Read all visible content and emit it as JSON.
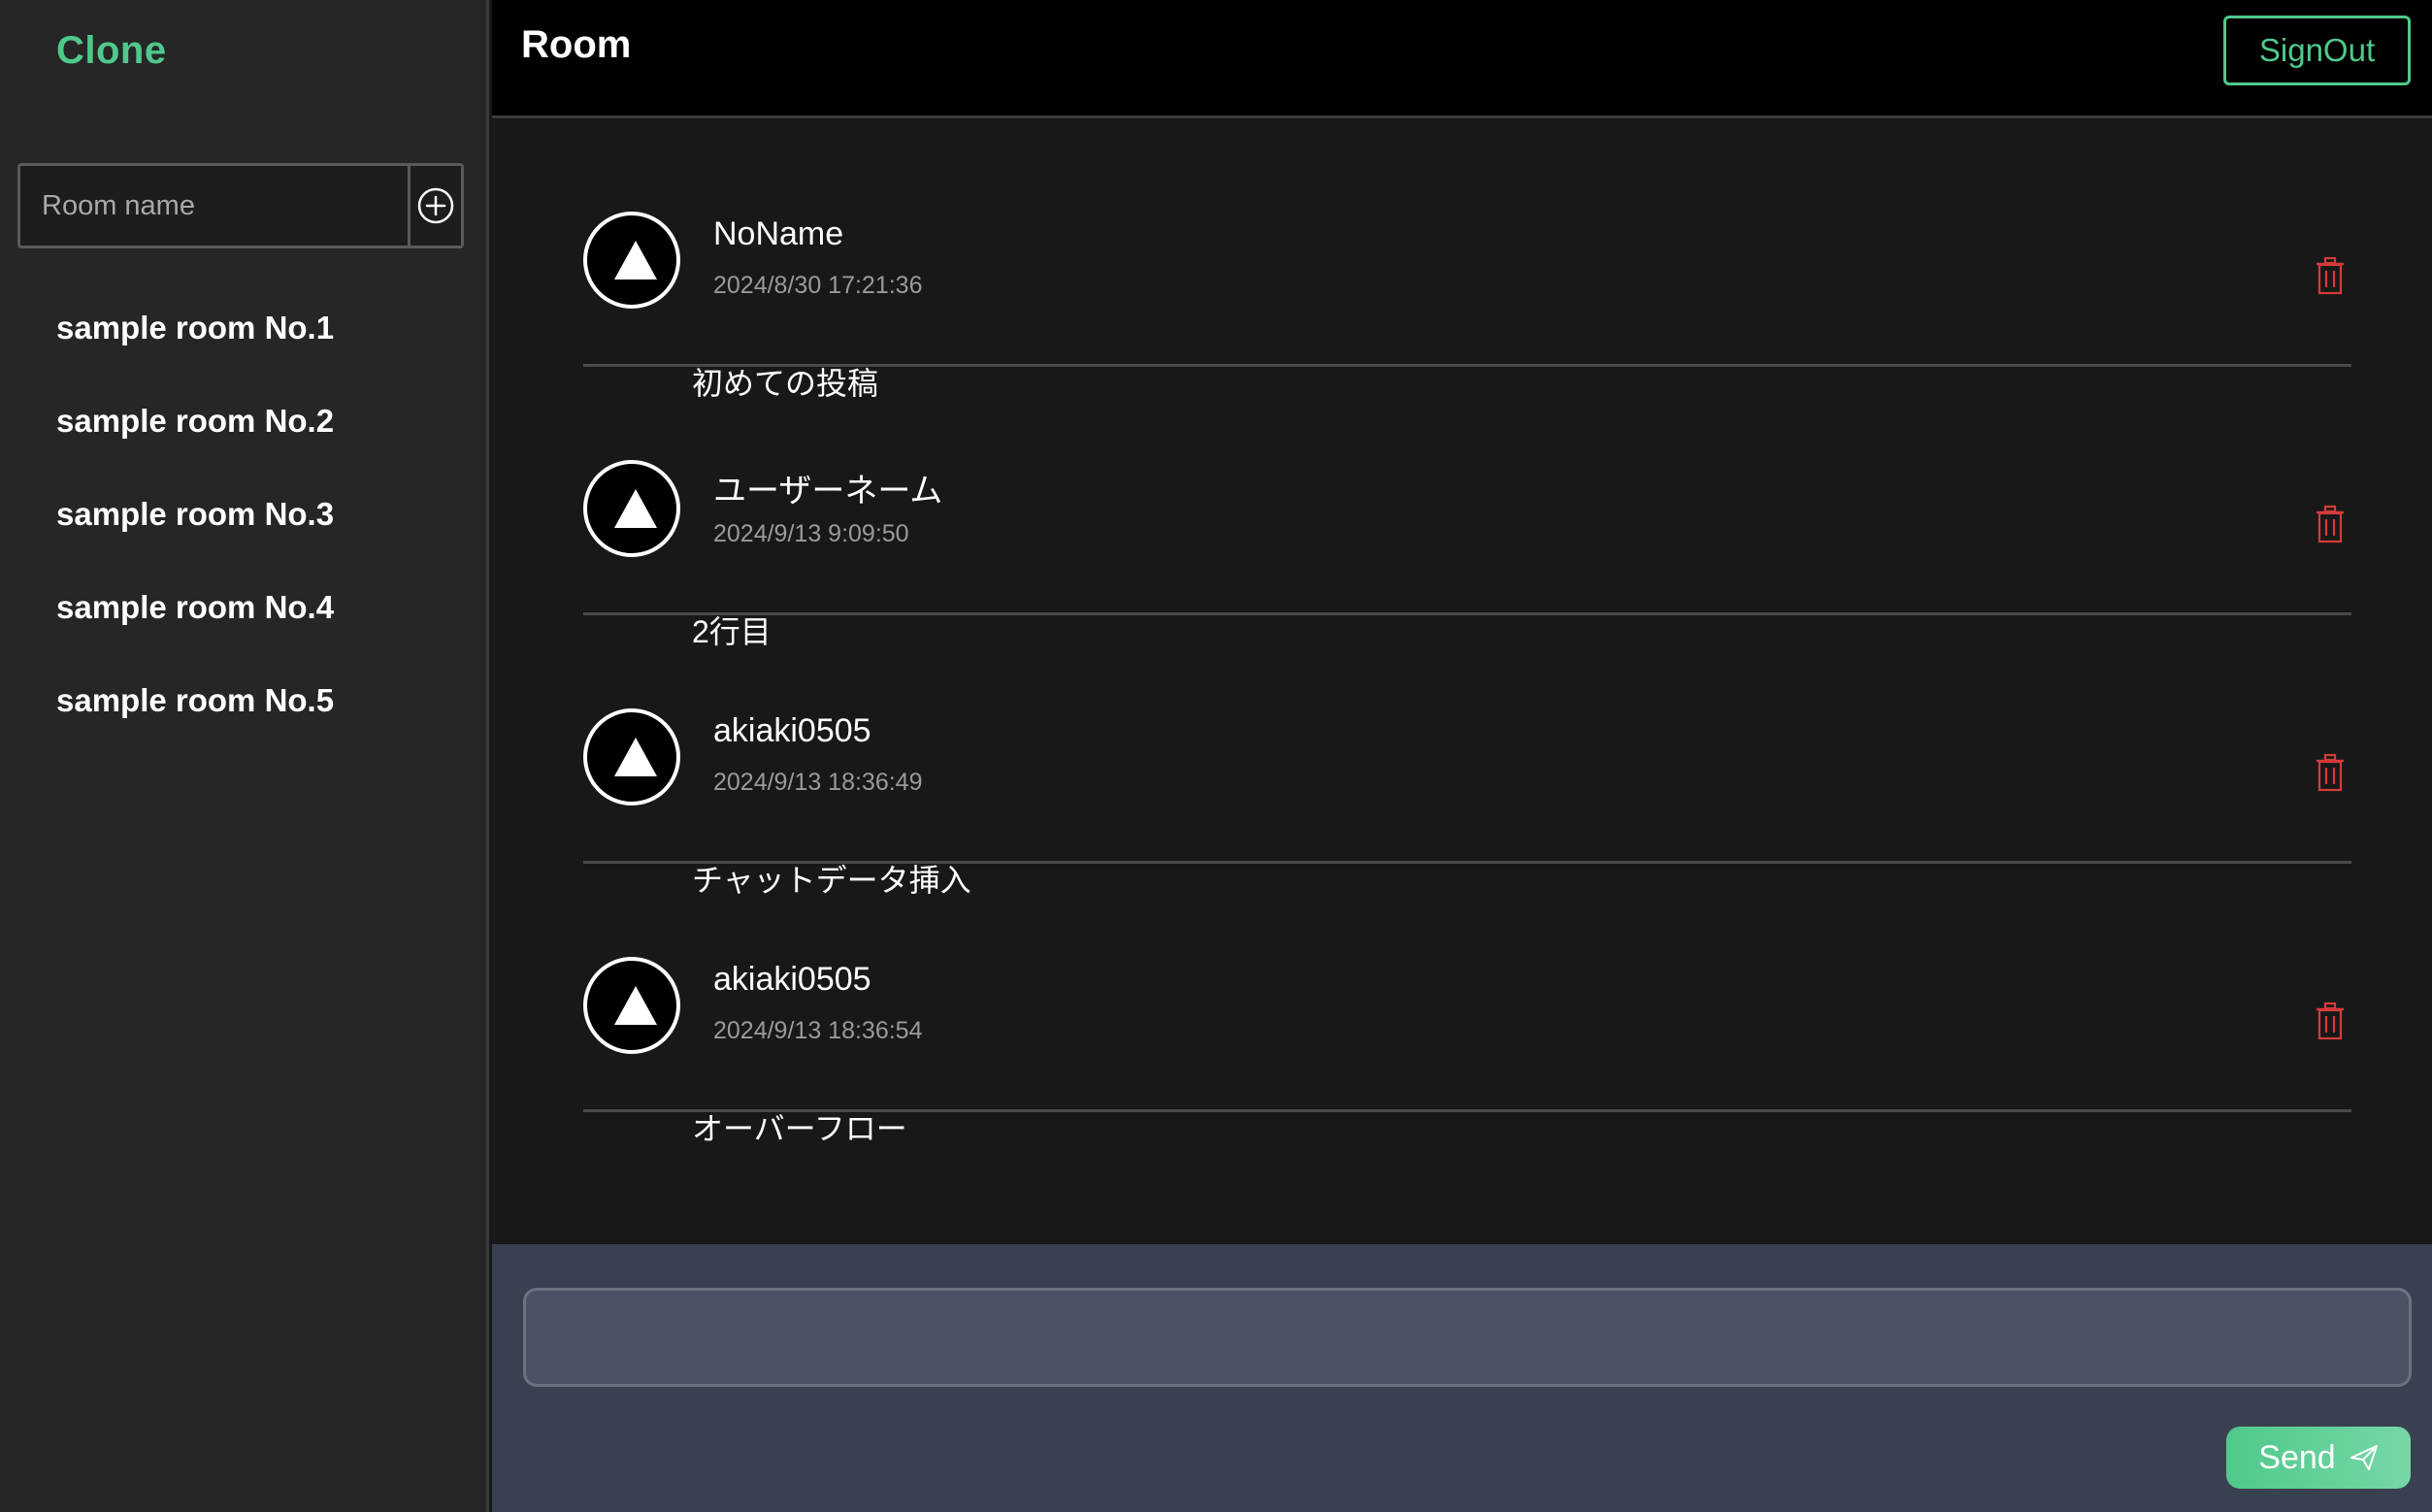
{
  "app": {
    "brand": "Clone",
    "accent_color": "#4fc98b",
    "delete_color": "#d63a3a"
  },
  "sidebar": {
    "room_input_placeholder": "Room name",
    "add_icon": "plus-circle-icon",
    "rooms": [
      {
        "label": "sample room No.1"
      },
      {
        "label": "sample room No.2"
      },
      {
        "label": "sample room No.3"
      },
      {
        "label": "sample room No.4"
      },
      {
        "label": "sample room No.5"
      }
    ]
  },
  "header": {
    "title": "Room",
    "signout_label": "SignOut"
  },
  "messages": [
    {
      "user": "NoName",
      "timestamp": "2024/8/30 17:21:36",
      "text": "初めての投稿",
      "avatar_icon": "triangle-icon",
      "delete_icon": "trash-icon"
    },
    {
      "user": "ユーザーネーム",
      "timestamp": "2024/9/13 9:09:50",
      "text": "2行目",
      "avatar_icon": "triangle-icon",
      "delete_icon": "trash-icon"
    },
    {
      "user": "akiaki0505",
      "timestamp": "2024/9/13 18:36:49",
      "text": "チャットデータ挿入",
      "avatar_icon": "triangle-icon",
      "delete_icon": "trash-icon"
    },
    {
      "user": "akiaki0505",
      "timestamp": "2024/9/13 18:36:54",
      "text": "オーバーフロー",
      "avatar_icon": "triangle-icon",
      "delete_icon": "trash-icon"
    }
  ],
  "composer": {
    "input_value": "",
    "send_label": "Send",
    "send_icon": "paper-plane-icon"
  }
}
